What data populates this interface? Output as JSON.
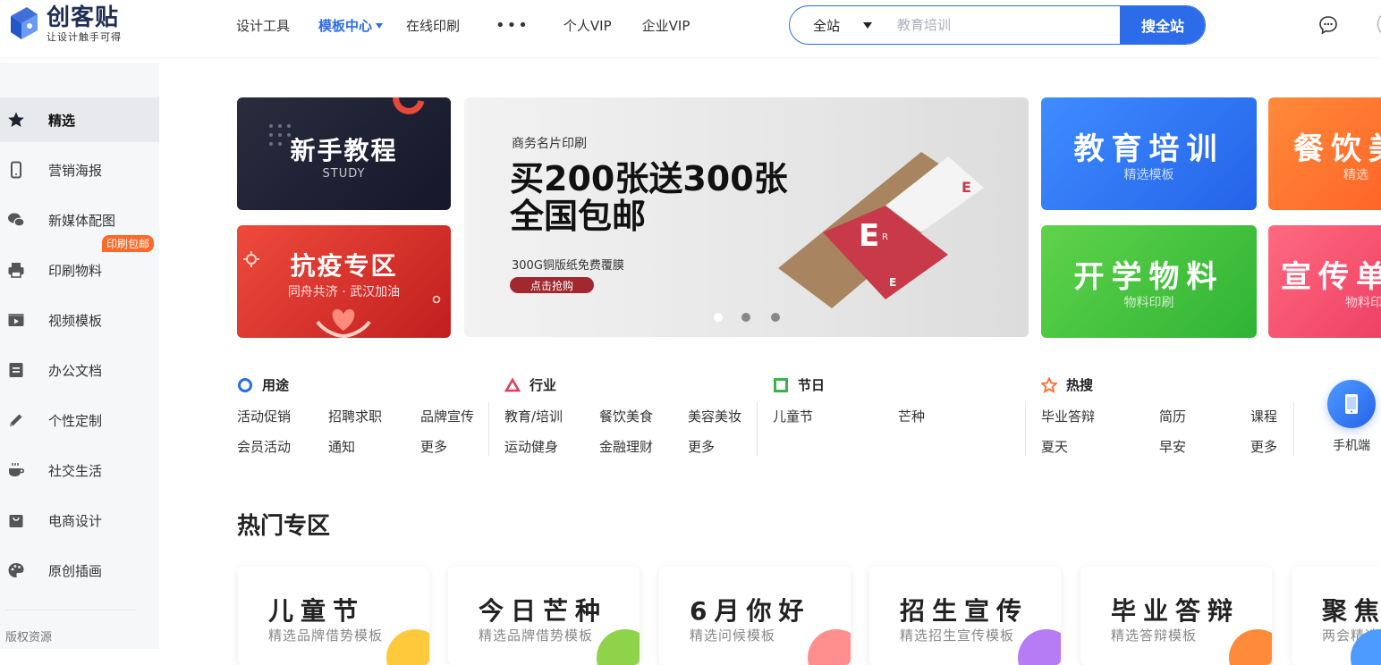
{
  "brand": {
    "name": "创客贴",
    "slogan": "让设计触手可得"
  },
  "nav": {
    "items": [
      "设计工具",
      "模板中心",
      "在线印刷",
      "•••",
      "个人VIP",
      "企业VIP"
    ],
    "active_index": 1
  },
  "search": {
    "scope": "全站",
    "placeholder": "教育培训",
    "button": "搜全站"
  },
  "sidebar": {
    "items": [
      {
        "label": "精选",
        "icon": "star-icon",
        "active": true
      },
      {
        "label": "营销海报",
        "icon": "phone-icon"
      },
      {
        "label": "新媒体配图",
        "icon": "wechat-icon"
      },
      {
        "label": "印刷物料",
        "icon": "printer-icon",
        "badge": "印刷包邮"
      },
      {
        "label": "视频模板",
        "icon": "video-icon"
      },
      {
        "label": "办公文档",
        "icon": "document-icon"
      },
      {
        "label": "个性定制",
        "icon": "pencil-icon"
      },
      {
        "label": "社交生活",
        "icon": "coffee-icon"
      },
      {
        "label": "电商设计",
        "icon": "shopping-bag-icon"
      },
      {
        "label": "原创插画",
        "icon": "palette-icon"
      }
    ],
    "footer": "版权资源"
  },
  "banners": {
    "newbie": {
      "title": "新手教程",
      "sub": "STUDY"
    },
    "covid": {
      "title": "抗疫专区",
      "sub": "同舟共济 · 武汉加油"
    },
    "main": {
      "small": "商务名片印刷",
      "line1": "买200张送300张",
      "line2": "全国包邮",
      "note": "300G铜版纸免费覆膜",
      "button": "点击抢购",
      "slides": 3,
      "active_slide": 0
    },
    "edu": {
      "title": "教育培训",
      "sub": "精选模板"
    },
    "food": {
      "title": "餐饮美",
      "sub": "精选"
    },
    "school": {
      "title": "开学物料",
      "sub": "物料印刷"
    },
    "promo": {
      "title": "宣传单",
      "sub": "物料印"
    }
  },
  "categories": {
    "usage": {
      "title": "用途",
      "tags": [
        "活动促销",
        "招聘求职",
        "品牌宣传",
        "会员活动",
        "通知",
        "更多"
      ]
    },
    "industry": {
      "title": "行业",
      "tags": [
        "教育/培训",
        "餐饮美食",
        "美容美妆",
        "运动健身",
        "金融理财",
        "更多"
      ]
    },
    "holiday": {
      "title": "节日",
      "tags": [
        "儿童节",
        "芒种"
      ]
    },
    "hot": {
      "title": "热搜",
      "tags": [
        "毕业答辩",
        "简历",
        "课程",
        "夏天",
        "早安",
        "更多"
      ]
    }
  },
  "mobile_label": "手机端",
  "hot_section": {
    "title": "热门专区",
    "cards": [
      {
        "title": "儿童节",
        "sub": "精选品牌借势模板",
        "color": "#ffc93c"
      },
      {
        "title": "今日芒种",
        "sub": "精选品牌借势模板",
        "color": "#8fd34a"
      },
      {
        "title": "6月你好",
        "sub": "精选问候模板",
        "color": "#ff8f8f"
      },
      {
        "title": "招生宣传",
        "sub": "精选招生宣传模板",
        "color": "#b57cf5"
      },
      {
        "title": "毕业答辩",
        "sub": "精选答辩模板",
        "color": "#ff8a3a"
      },
      {
        "title": "聚焦",
        "sub": "两会精选",
        "color": "#4e9bff"
      }
    ]
  },
  "colors": {
    "accent": "#2d6ce8",
    "badge": "#ff6a2a"
  }
}
